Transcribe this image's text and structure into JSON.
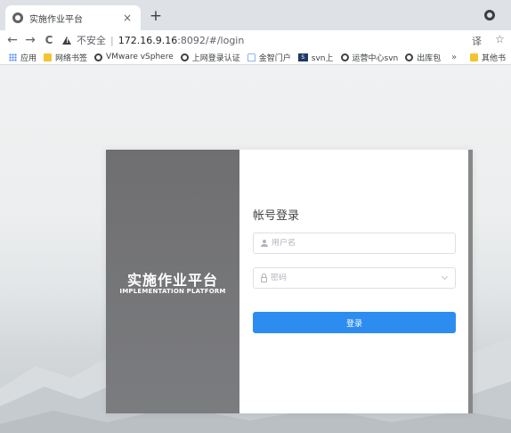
{
  "tab": {
    "title": "实施作业平台",
    "close": "×",
    "new_tab": "+"
  },
  "toolbar": {
    "back": "←",
    "forward": "→",
    "reload": "C",
    "insecure_label": "不安全",
    "separator": "|",
    "url_host": "172.16.9.16",
    "url_rest": ":8092/#/login",
    "translate": "译",
    "star": "☆"
  },
  "bookmarks": {
    "items": [
      {
        "label": "应用",
        "icon": "apps-icon"
      },
      {
        "label": "网络书签",
        "icon": "folder-icon"
      },
      {
        "label": "VMware vSphere",
        "icon": "globe-icon"
      },
      {
        "label": "上网登录认证",
        "icon": "globe-icon"
      },
      {
        "label": "金智门户",
        "icon": "home-icon"
      },
      {
        "label": "svn上",
        "icon": "svn-icon"
      },
      {
        "label": "运营中心svn",
        "icon": "globe-icon"
      },
      {
        "label": "出库包",
        "icon": "globe-icon"
      }
    ],
    "more": "»",
    "other_label": "其他书"
  },
  "brand": {
    "title": "实施作业平台",
    "subtitle": "IMPLEMENTATION PLATFORM"
  },
  "login": {
    "heading": "帐号登录",
    "username_placeholder": "用户名",
    "password_placeholder": "密码",
    "submit_label": "登录"
  },
  "colors": {
    "primary": "#2d8cf0",
    "brand_panel": "#737477"
  }
}
